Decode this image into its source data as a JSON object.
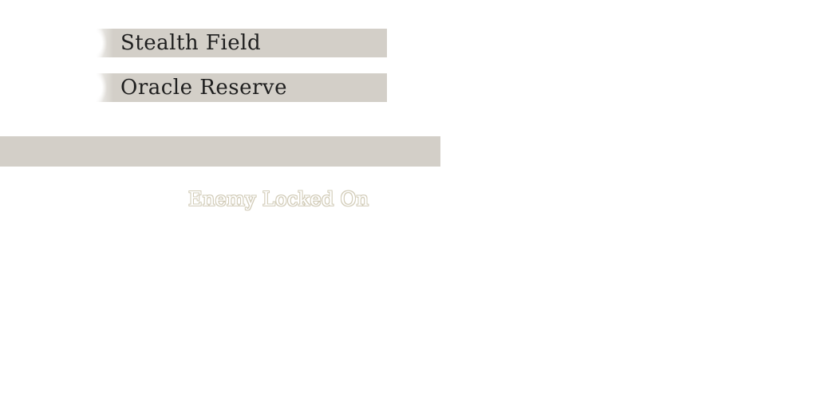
{
  "abilities": [
    {
      "label": "Stealth Field"
    },
    {
      "label": "Oracle Reserve"
    }
  ],
  "status": {
    "message": "Enemy Locked On"
  },
  "colors": {
    "panel": "#d3cfc8",
    "label_text": "#1e1e1e",
    "message_outline": "#d2ccb8"
  }
}
